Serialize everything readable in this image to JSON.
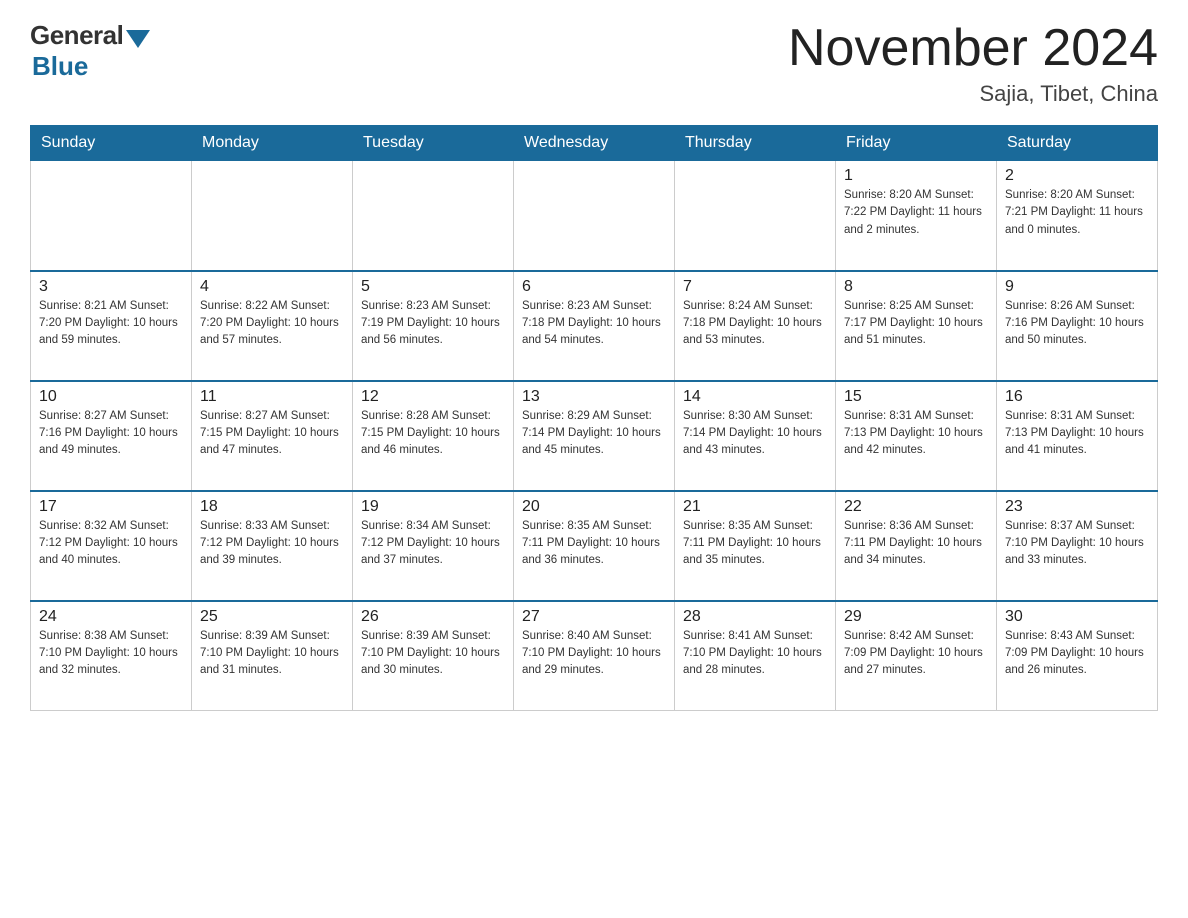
{
  "header": {
    "logo_general": "General",
    "logo_blue": "Blue",
    "month_title": "November 2024",
    "location": "Sajia, Tibet, China"
  },
  "weekdays": [
    "Sunday",
    "Monday",
    "Tuesday",
    "Wednesday",
    "Thursday",
    "Friday",
    "Saturday"
  ],
  "weeks": [
    [
      {
        "day": "",
        "info": ""
      },
      {
        "day": "",
        "info": ""
      },
      {
        "day": "",
        "info": ""
      },
      {
        "day": "",
        "info": ""
      },
      {
        "day": "",
        "info": ""
      },
      {
        "day": "1",
        "info": "Sunrise: 8:20 AM\nSunset: 7:22 PM\nDaylight: 11 hours\nand 2 minutes."
      },
      {
        "day": "2",
        "info": "Sunrise: 8:20 AM\nSunset: 7:21 PM\nDaylight: 11 hours\nand 0 minutes."
      }
    ],
    [
      {
        "day": "3",
        "info": "Sunrise: 8:21 AM\nSunset: 7:20 PM\nDaylight: 10 hours\nand 59 minutes."
      },
      {
        "day": "4",
        "info": "Sunrise: 8:22 AM\nSunset: 7:20 PM\nDaylight: 10 hours\nand 57 minutes."
      },
      {
        "day": "5",
        "info": "Sunrise: 8:23 AM\nSunset: 7:19 PM\nDaylight: 10 hours\nand 56 minutes."
      },
      {
        "day": "6",
        "info": "Sunrise: 8:23 AM\nSunset: 7:18 PM\nDaylight: 10 hours\nand 54 minutes."
      },
      {
        "day": "7",
        "info": "Sunrise: 8:24 AM\nSunset: 7:18 PM\nDaylight: 10 hours\nand 53 minutes."
      },
      {
        "day": "8",
        "info": "Sunrise: 8:25 AM\nSunset: 7:17 PM\nDaylight: 10 hours\nand 51 minutes."
      },
      {
        "day": "9",
        "info": "Sunrise: 8:26 AM\nSunset: 7:16 PM\nDaylight: 10 hours\nand 50 minutes."
      }
    ],
    [
      {
        "day": "10",
        "info": "Sunrise: 8:27 AM\nSunset: 7:16 PM\nDaylight: 10 hours\nand 49 minutes."
      },
      {
        "day": "11",
        "info": "Sunrise: 8:27 AM\nSunset: 7:15 PM\nDaylight: 10 hours\nand 47 minutes."
      },
      {
        "day": "12",
        "info": "Sunrise: 8:28 AM\nSunset: 7:15 PM\nDaylight: 10 hours\nand 46 minutes."
      },
      {
        "day": "13",
        "info": "Sunrise: 8:29 AM\nSunset: 7:14 PM\nDaylight: 10 hours\nand 45 minutes."
      },
      {
        "day": "14",
        "info": "Sunrise: 8:30 AM\nSunset: 7:14 PM\nDaylight: 10 hours\nand 43 minutes."
      },
      {
        "day": "15",
        "info": "Sunrise: 8:31 AM\nSunset: 7:13 PM\nDaylight: 10 hours\nand 42 minutes."
      },
      {
        "day": "16",
        "info": "Sunrise: 8:31 AM\nSunset: 7:13 PM\nDaylight: 10 hours\nand 41 minutes."
      }
    ],
    [
      {
        "day": "17",
        "info": "Sunrise: 8:32 AM\nSunset: 7:12 PM\nDaylight: 10 hours\nand 40 minutes."
      },
      {
        "day": "18",
        "info": "Sunrise: 8:33 AM\nSunset: 7:12 PM\nDaylight: 10 hours\nand 39 minutes."
      },
      {
        "day": "19",
        "info": "Sunrise: 8:34 AM\nSunset: 7:12 PM\nDaylight: 10 hours\nand 37 minutes."
      },
      {
        "day": "20",
        "info": "Sunrise: 8:35 AM\nSunset: 7:11 PM\nDaylight: 10 hours\nand 36 minutes."
      },
      {
        "day": "21",
        "info": "Sunrise: 8:35 AM\nSunset: 7:11 PM\nDaylight: 10 hours\nand 35 minutes."
      },
      {
        "day": "22",
        "info": "Sunrise: 8:36 AM\nSunset: 7:11 PM\nDaylight: 10 hours\nand 34 minutes."
      },
      {
        "day": "23",
        "info": "Sunrise: 8:37 AM\nSunset: 7:10 PM\nDaylight: 10 hours\nand 33 minutes."
      }
    ],
    [
      {
        "day": "24",
        "info": "Sunrise: 8:38 AM\nSunset: 7:10 PM\nDaylight: 10 hours\nand 32 minutes."
      },
      {
        "day": "25",
        "info": "Sunrise: 8:39 AM\nSunset: 7:10 PM\nDaylight: 10 hours\nand 31 minutes."
      },
      {
        "day": "26",
        "info": "Sunrise: 8:39 AM\nSunset: 7:10 PM\nDaylight: 10 hours\nand 30 minutes."
      },
      {
        "day": "27",
        "info": "Sunrise: 8:40 AM\nSunset: 7:10 PM\nDaylight: 10 hours\nand 29 minutes."
      },
      {
        "day": "28",
        "info": "Sunrise: 8:41 AM\nSunset: 7:10 PM\nDaylight: 10 hours\nand 28 minutes."
      },
      {
        "day": "29",
        "info": "Sunrise: 8:42 AM\nSunset: 7:09 PM\nDaylight: 10 hours\nand 27 minutes."
      },
      {
        "day": "30",
        "info": "Sunrise: 8:43 AM\nSunset: 7:09 PM\nDaylight: 10 hours\nand 26 minutes."
      }
    ]
  ]
}
